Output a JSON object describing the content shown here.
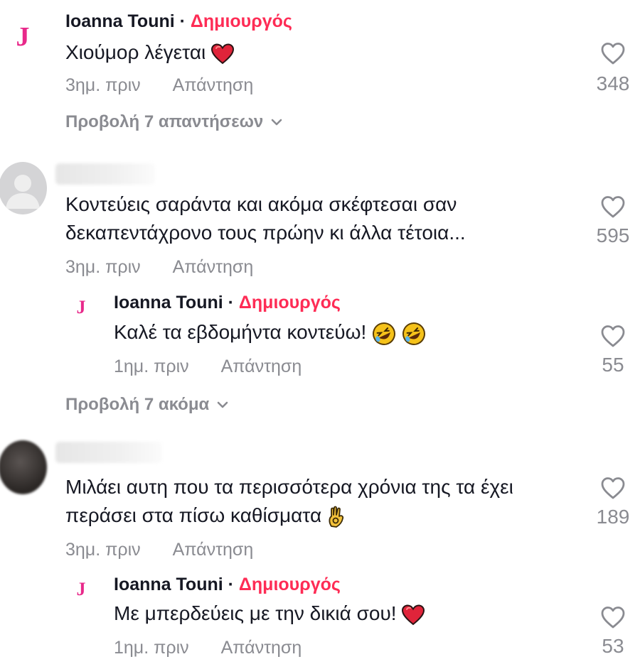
{
  "comments": [
    {
      "author": "Ioanna Touni",
      "separator": "·",
      "badge": "Δημιουργός",
      "avatar_letter": "J",
      "text": "Χιούμορ λέγεται",
      "text_emoji": "red-heart",
      "time": "3ημ. πριν",
      "reply_label": "Απάντηση",
      "likes": "348",
      "view_replies": "Προβολή 7 απαντήσεων"
    },
    {
      "author": "",
      "text_line1": "Κοντεύεις σαράντα και ακόμα σκέφτεσαι σαν",
      "text_line2": "δεκαπεντάχρονο τους πρώην κι άλλα τέτοια...",
      "time": "3ημ. πριν",
      "reply_label": "Απάντηση",
      "likes": "595",
      "reply": {
        "author": "Ioanna Touni",
        "separator": "·",
        "badge": "Δημιουργός",
        "avatar_letter": "J",
        "text": "Καλέ τα εβδομήντα κοντεύω!",
        "text_emoji": "rolling-laughing",
        "time": "1ημ. πριν",
        "reply_label": "Απάντηση",
        "likes": "55"
      },
      "view_more": "Προβολή 7 ακόμα"
    },
    {
      "author": "",
      "text_line1": "Μιλάει αυτη που τα περισσότερα χρόνια της τα έχει",
      "text_line2": "περάσει στα πίσω καθίσματα",
      "text_emoji": "ok-hand",
      "time": "3ημ. πριν",
      "reply_label": "Απάντηση",
      "likes": "189",
      "reply": {
        "author": "Ioanna Touni",
        "separator": "·",
        "badge": "Δημιουργός",
        "avatar_letter": "J",
        "text": "Με μπερδεύεις με την δικιά σου!",
        "text_emoji": "red-heart",
        "time": "1ημ. πριν",
        "reply_label": "Απάντηση",
        "likes": "53"
      }
    }
  ],
  "colors": {
    "creator_badge": "#fe2c55",
    "avatar_j": "#e8298a",
    "muted": "#8a8b91",
    "text": "#161823"
  }
}
